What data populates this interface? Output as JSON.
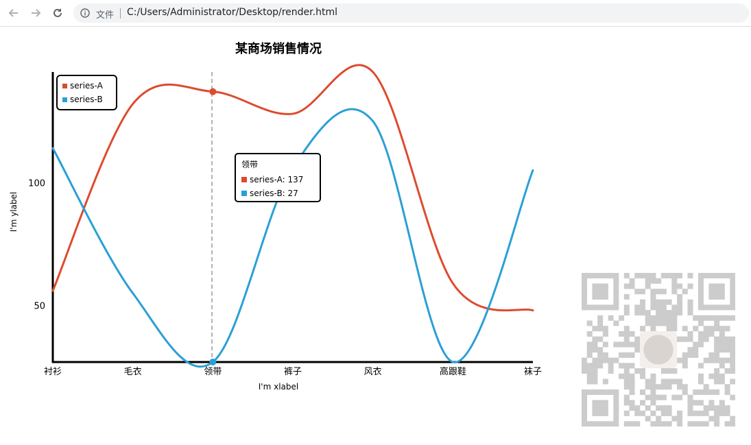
{
  "browser": {
    "address_label": "文件",
    "url": "C:/Users/Administrator/Desktop/render.html"
  },
  "colors": {
    "series_a": "#dd4b2e",
    "series_b": "#2a9fd6",
    "axis": "#000000",
    "qr": "#cccccc"
  },
  "chart_data": {
    "type": "line",
    "title": "某商场销售情况",
    "xlabel": "I'm xlabel",
    "ylabel": "I'm ylabel",
    "categories": [
      "衬衫",
      "毛衣",
      "领带",
      "裤子",
      "风衣",
      "高跟鞋",
      "袜子"
    ],
    "series": [
      {
        "name": "series-A",
        "values": [
          56,
          132,
          137,
          128,
          145,
          59,
          48
        ]
      },
      {
        "name": "series-B",
        "values": [
          114,
          55,
          27,
          106,
          125,
          27,
          105
        ]
      }
    ],
    "yticks": [
      50,
      100
    ],
    "ylim": [
      27,
      145
    ],
    "smooth": true,
    "legend": "top-left",
    "grid": false
  },
  "tooltip": {
    "title": "领带",
    "rows": [
      "series-A: 137",
      "series-B: 27"
    ]
  },
  "qr_icon": "qr-code-icon"
}
